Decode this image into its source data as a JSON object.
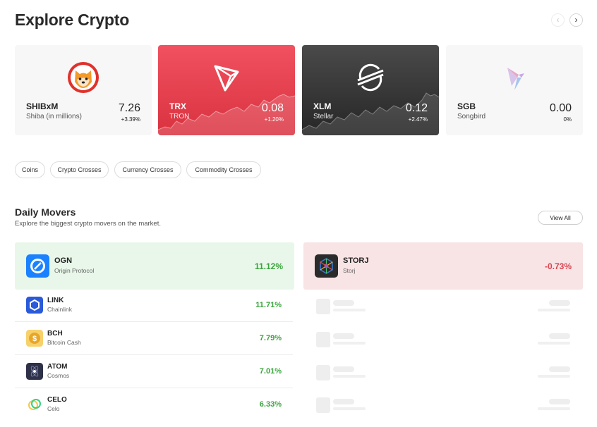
{
  "header": {
    "title": "Explore Crypto",
    "prev_icon": "chevron-left-icon",
    "next_icon": "chevron-right-icon"
  },
  "featured": [
    {
      "symbol": "SHIBxM",
      "name": "Shiba (in millions)",
      "price": "7.26",
      "change": "+3.39%",
      "icon": "shiba-logo-icon"
    },
    {
      "symbol": "TRX",
      "name": "TRON",
      "price": "0.08",
      "change": "+1.20%",
      "icon": "tron-logo-icon",
      "bg": "#e8404d"
    },
    {
      "symbol": "XLM",
      "name": "Stellar",
      "price": "0.12",
      "change": "+2.47%",
      "icon": "stellar-logo-icon",
      "bg": "#333333"
    },
    {
      "symbol": "SGB",
      "name": "Songbird",
      "price": "0.00",
      "change": "0%",
      "icon": "songbird-logo-icon"
    }
  ],
  "filters": [
    "Coins",
    "Crypto Crosses",
    "Currency Crosses",
    "Commodity Crosses"
  ],
  "movers": {
    "title": "Daily Movers",
    "subtitle": "Explore the biggest crypto movers on the market.",
    "view_all": "View All",
    "top_gainer": {
      "symbol": "OGN",
      "name": "Origin Protocol",
      "change": "11.12%",
      "icon": "origin-logo-icon"
    },
    "top_loser": {
      "symbol": "STORJ",
      "name": "Storj",
      "change": "-0.73%",
      "icon": "storj-logo-icon"
    },
    "gainers": [
      {
        "symbol": "LINK",
        "name": "Chainlink",
        "change": "11.71%",
        "icon": "chainlink-logo-icon"
      },
      {
        "symbol": "BCH",
        "name": "Bitcoin Cash",
        "change": "7.79%",
        "icon": "bitcoin-cash-logo-icon"
      },
      {
        "symbol": "ATOM",
        "name": "Cosmos",
        "change": "7.01%",
        "icon": "cosmos-logo-icon"
      },
      {
        "symbol": "CELO",
        "name": "Celo",
        "change": "6.33%",
        "icon": "celo-logo-icon"
      }
    ]
  },
  "colors": {
    "gain": "#3aa43d",
    "loss": "#d64550",
    "gain_bg": "#e8f7e9",
    "loss_bg": "#f8e3e5"
  }
}
